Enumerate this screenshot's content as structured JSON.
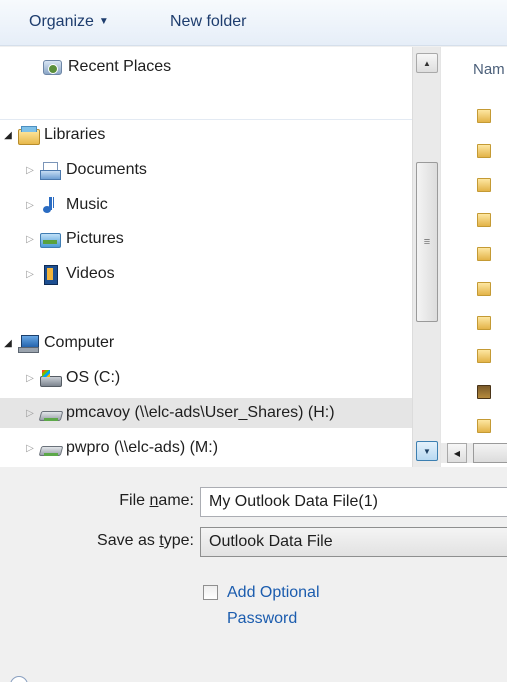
{
  "toolbar": {
    "organize_label": "Organize",
    "new_folder_label": "New folder"
  },
  "nav": {
    "recent_places": "Recent Places",
    "libraries": "Libraries",
    "library_items": [
      "Documents",
      "Music",
      "Pictures",
      "Videos"
    ],
    "computer": "Computer",
    "drives": [
      "OS (C:)",
      "pmcavoy (\\\\elc-ads\\User_Shares) (H:)",
      "pwpro (\\\\elc-ads) (M:)"
    ],
    "selected_item": "pmcavoy (\\\\elc-ads\\User_Shares) (H:)"
  },
  "filelist": {
    "column_header": "Nam"
  },
  "form": {
    "file_name_label_pre": "File ",
    "file_name_label_u": "n",
    "file_name_label_post": "ame:",
    "file_name_value": "My Outlook Data File(1)",
    "save_type_label_pre": "Save as ",
    "save_type_label_u": "t",
    "save_type_label_post": "ype:",
    "save_type_value": "Outlook Data File",
    "add_password_label": "Add Optional Password"
  }
}
